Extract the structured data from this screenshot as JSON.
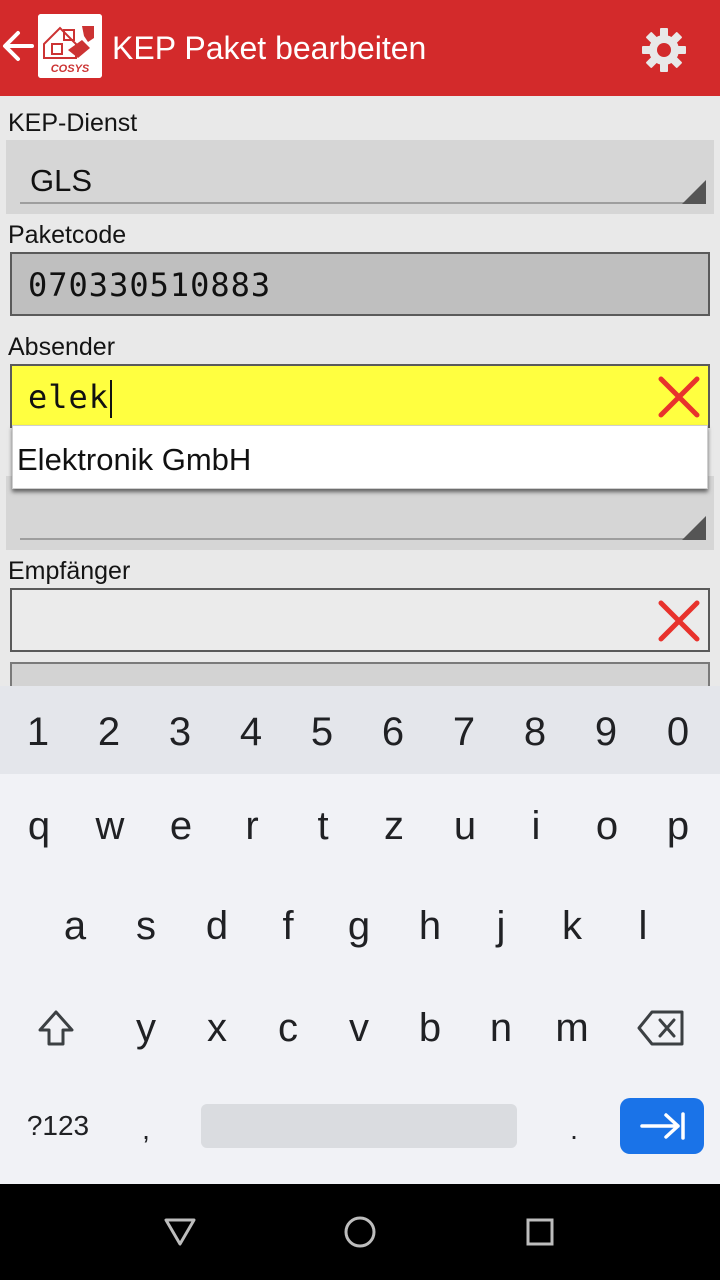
{
  "app_bar": {
    "title": "KEP Paket bearbeiten",
    "logo_text": "COSYS",
    "color": "#d32a2b"
  },
  "form": {
    "kep_label": "KEP-Dienst",
    "kep_value": "GLS",
    "paketcode_label": "Paketcode",
    "paketcode_value": "070330510883",
    "absender_label": "Absender",
    "absender_value": "elek",
    "suggestion": "Elektronik GmbH",
    "hidden_spinner_value": "",
    "empfaenger_label": "Empfänger",
    "empfaenger_value": ""
  },
  "keyboard": {
    "numbers": [
      "1",
      "2",
      "3",
      "4",
      "5",
      "6",
      "7",
      "8",
      "9",
      "0"
    ],
    "row1": [
      "q",
      "w",
      "e",
      "r",
      "t",
      "z",
      "u",
      "i",
      "o",
      "p"
    ],
    "row2": [
      "a",
      "s",
      "d",
      "f",
      "g",
      "h",
      "j",
      "k",
      "l"
    ],
    "row3": [
      "y",
      "x",
      "c",
      "v",
      "b",
      "n",
      "m"
    ],
    "symbols_label": "?123",
    "comma": ",",
    "period": "."
  },
  "icons": {
    "back": "arrow-left-icon",
    "settings": "gear-icon",
    "clear": "red-x-icon",
    "shift": "shift-icon",
    "backspace": "backspace-icon",
    "tab": "tab-arrow-icon",
    "nav_back": "triangle-back-icon",
    "nav_home": "circle-home-icon",
    "nav_recents": "square-recents-icon"
  },
  "colors": {
    "active_field": "#ffff40",
    "clear_x": "#e8322c",
    "enter_key": "#1a73e8"
  }
}
